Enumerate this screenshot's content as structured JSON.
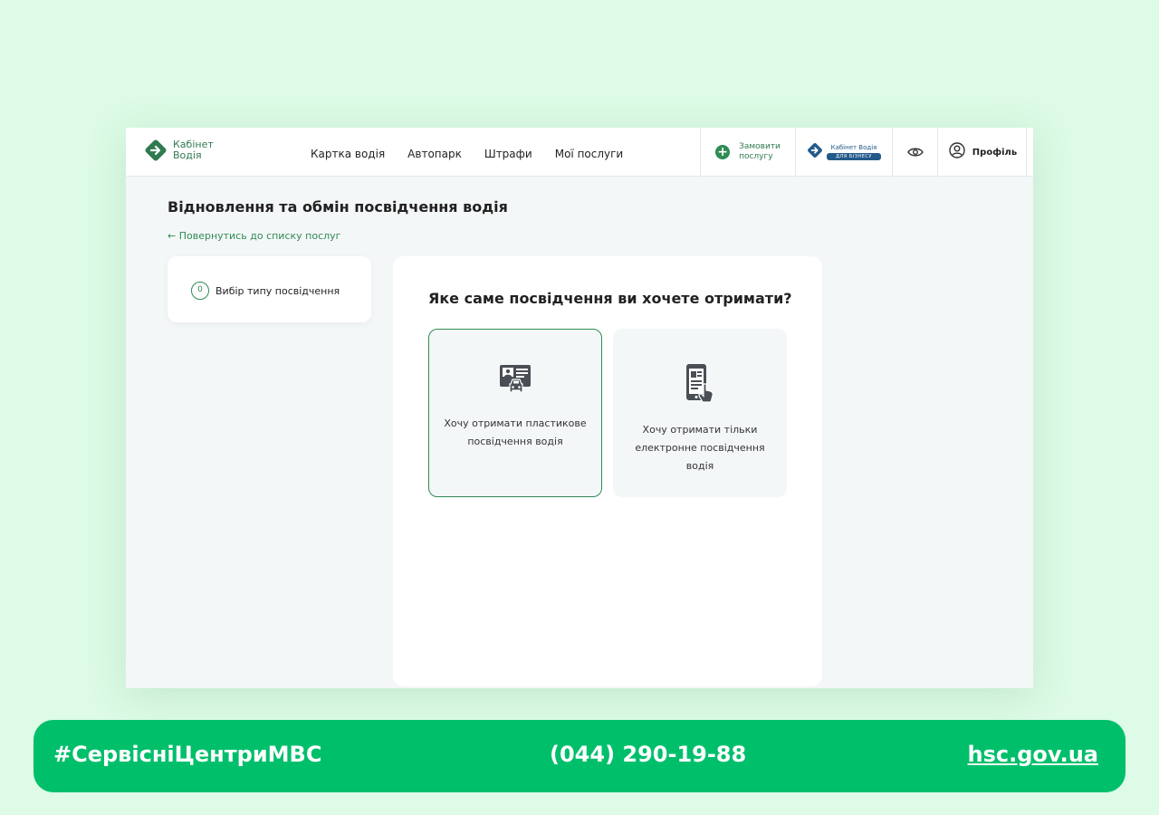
{
  "header": {
    "logo_line1": "Кабінет",
    "logo_line2": "Водія",
    "nav": [
      "Картка водія",
      "Автопарк",
      "Штрафи",
      "Мої послуги"
    ],
    "order_line1": "Замовити",
    "order_line2": "послугу",
    "biz_title": "Кабінет Водія",
    "biz_badge": "ДЛЯ БІЗНЕСУ",
    "profile_label": "Профіль",
    "icons": {
      "logo": "arrow-diamond-icon",
      "order": "plus-circle-icon",
      "biz": "arrow-diamond-icon",
      "accessibility": "eye-icon",
      "profile": "user-circle-icon"
    }
  },
  "page": {
    "title": "Відновлення та обмін посвідчення водія",
    "back_link": "← Повернутись до списку послуг"
  },
  "steps": [
    {
      "number": "0",
      "label": "Вибір типу посвідчення"
    }
  ],
  "main": {
    "question": "Яке саме посвідчення ви хочете отримати?",
    "options": [
      {
        "label": "Хочу отримати пластикове посвідчення водія",
        "icon": "plastic-license-icon",
        "selected": true
      },
      {
        "label": "Хочу отримати тільки електронне посвідчення водія",
        "icon": "phone-license-icon",
        "selected": false
      }
    ]
  },
  "footer": {
    "hashtag": "#СервісніЦентриМВС",
    "phone": "(044) 290-19-88",
    "site": "hsc.gov.ua"
  },
  "colors": {
    "background": "#ddfbe6",
    "accent": "#2f8b55",
    "footer": "#00bf6b",
    "biz_blue": "#235a8a"
  }
}
